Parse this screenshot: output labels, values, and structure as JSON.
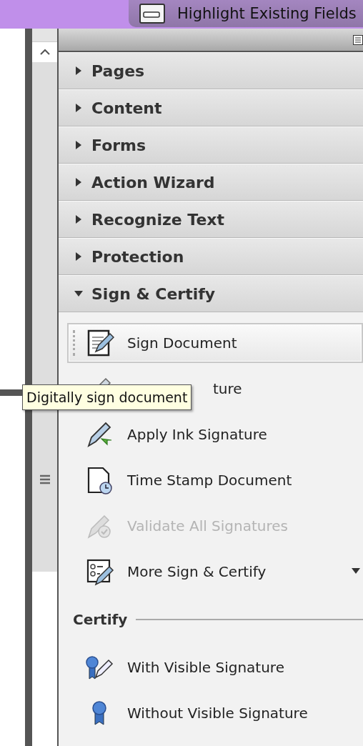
{
  "top_bar": {
    "button_label": "Highlight Existing Fields"
  },
  "panel_sections": [
    {
      "label": "Pages",
      "expanded": false
    },
    {
      "label": "Content",
      "expanded": false
    },
    {
      "label": "Forms",
      "expanded": false
    },
    {
      "label": "Action Wizard",
      "expanded": false
    },
    {
      "label": "Recognize Text",
      "expanded": false
    },
    {
      "label": "Protection",
      "expanded": false
    },
    {
      "label": "Sign & Certify",
      "expanded": true,
      "items": [
        {
          "label": "Sign Document",
          "kind": "sign",
          "selected": true,
          "disabled": false
        },
        {
          "label": "ture",
          "kind": "place",
          "selected": false,
          "disabled": false
        },
        {
          "label": "Apply Ink Signature",
          "kind": "ink",
          "selected": false,
          "disabled": false
        },
        {
          "label": "Time Stamp Document",
          "kind": "timestamp",
          "selected": false,
          "disabled": false
        },
        {
          "label": "Validate All Signatures",
          "kind": "validate",
          "selected": false,
          "disabled": true
        },
        {
          "label": "More Sign & Certify",
          "kind": "more",
          "selected": false,
          "disabled": false
        }
      ],
      "subsections": [
        {
          "heading": "Certify",
          "items": [
            {
              "label": "With Visible Signature",
              "kind": "certify-visible",
              "selected": false,
              "disabled": false
            },
            {
              "label": "Without Visible Signature",
              "kind": "certify",
              "selected": false,
              "disabled": false
            }
          ]
        }
      ]
    }
  ],
  "tooltip": {
    "text": "Digitally sign document"
  }
}
